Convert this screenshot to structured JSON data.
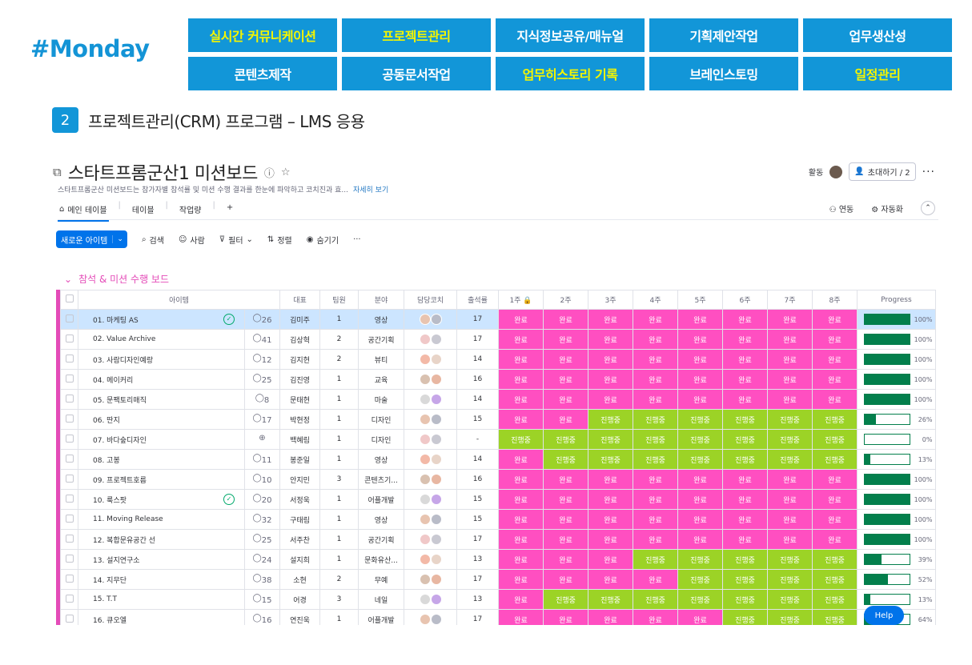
{
  "brand": "#Monday",
  "nav": {
    "row1": [
      {
        "label": "실시간 커뮤니케이션",
        "hl": true
      },
      {
        "label": "프로젝트관리",
        "hl": true
      },
      {
        "label": "지식정보공유/매뉴얼",
        "hl": false
      },
      {
        "label": "기획제안작업",
        "hl": false
      },
      {
        "label": "업무생산성",
        "hl": false
      }
    ],
    "row2": [
      {
        "label": "콘텐츠제작",
        "hl": false
      },
      {
        "label": "공동문서작업",
        "hl": false
      },
      {
        "label": "업무히스토리 기록",
        "hl": true
      },
      {
        "label": "브레인스토밍",
        "hl": false
      },
      {
        "label": "일정관리",
        "hl": true
      }
    ],
    "highlight_color": "#f5f500",
    "bg_color": "#1296d8"
  },
  "section": {
    "number": "2",
    "title": "프로젝트관리(CRM) 프로그램 – LMS 응용"
  },
  "board": {
    "title": "스타트프롬군산1 미션보드",
    "description": "스타트프롬군산 미션보드는 참가자별 참석률 및 미션 수행 결과를 한눈에 파악하고 코치진과 효...",
    "more_link": "자세히 보기",
    "activity": "활동",
    "invite": "초대하기 / 2",
    "tabs": [
      "메인 테이블",
      "테이블",
      "작업량",
      "+"
    ],
    "integrate": "연동",
    "automate": "자동화",
    "new_item": "새로운 아이템",
    "search": "검색",
    "person": "사람",
    "filter": "필터",
    "sort": "정렬",
    "hide": "숨기기",
    "group_title": "참석 & 미션 수행 보드"
  },
  "table": {
    "headers": {
      "item": "아이템",
      "rep": "대표",
      "team": "팀원",
      "field": "분야",
      "coach": "담당코치",
      "att": "출석률",
      "progress": "Progress"
    },
    "weeks": [
      "1주",
      "2주",
      "3주",
      "4주",
      "5주",
      "6주",
      "7주",
      "8주"
    ],
    "status_done": "완료",
    "status_prog": "진행중",
    "rows": [
      {
        "name": "01. 마케팅 AS",
        "check": true,
        "msg": "26",
        "rep": "김미주",
        "team": "1",
        "field": "영상",
        "att": "17",
        "weeks": "DDDDDDDD",
        "progress": 100,
        "progress_label": "100%"
      },
      {
        "name": "02. Value Archive",
        "check": false,
        "msg": "41",
        "rep": "김상혁",
        "team": "2",
        "field": "공간기획",
        "att": "17",
        "weeks": "DDDDDDDD",
        "progress": 100,
        "progress_label": "100%"
      },
      {
        "name": "03. 사람디자인예랑",
        "check": false,
        "msg": "12",
        "rep": "김지현",
        "team": "2",
        "field": "뷰티",
        "att": "14",
        "weeks": "DDDDDDDD",
        "progress": 100,
        "progress_label": "100%"
      },
      {
        "name": "04. 메이커리",
        "check": false,
        "msg": "25",
        "rep": "김진영",
        "team": "1",
        "field": "교육",
        "att": "16",
        "weeks": "DDDDDDDD",
        "progress": 100,
        "progress_label": "100%"
      },
      {
        "name": "05. 문팩토리매직",
        "check": false,
        "msg": "8",
        "rep": "문태현",
        "team": "1",
        "field": "마술",
        "att": "14",
        "weeks": "DDDDDDDD",
        "progress": 100,
        "progress_label": "100%"
      },
      {
        "name": "06. 딴지",
        "check": false,
        "msg": "17",
        "rep": "박현정",
        "team": "1",
        "field": "디자인",
        "att": "15",
        "weeks": "DDPPPPPP",
        "progress": 26,
        "progress_label": "26%"
      },
      {
        "name": "07. 바다숲디자인",
        "check": false,
        "msg": "",
        "rep": "백혜림",
        "team": "1",
        "field": "디자인",
        "att": "-",
        "weeks": "PPPPPPPP",
        "progress": 0,
        "progress_label": "0%"
      },
      {
        "name": "08. 고봉",
        "check": false,
        "msg": "11",
        "rep": "봉준일",
        "team": "1",
        "field": "영상",
        "att": "14",
        "weeks": "DPPPPPPP",
        "progress": 13,
        "progress_label": "13%"
      },
      {
        "name": "09. 프로젝트호름",
        "check": false,
        "msg": "10",
        "rep": "안지민",
        "team": "3",
        "field": "콘텐츠기...",
        "att": "16",
        "weeks": "DDDDDDDD",
        "progress": 100,
        "progress_label": "100%"
      },
      {
        "name": "10. 룩스팟",
        "check": true,
        "msg": "20",
        "rep": "서정욱",
        "team": "1",
        "field": "어플개발",
        "att": "15",
        "weeks": "DDDDDDDD",
        "progress": 100,
        "progress_label": "100%"
      },
      {
        "name": "11. Moving Release",
        "check": false,
        "msg": "32",
        "rep": "구태림",
        "team": "1",
        "field": "영상",
        "att": "15",
        "weeks": "DDDDDDDD",
        "progress": 100,
        "progress_label": "100%"
      },
      {
        "name": "12. 복합문유공간 선",
        "check": false,
        "msg": "25",
        "rep": "서주찬",
        "team": "1",
        "field": "공간기획",
        "att": "17",
        "weeks": "DDDDDDDD",
        "progress": 100,
        "progress_label": "100%"
      },
      {
        "name": "13. 설지연구소",
        "check": false,
        "msg": "24",
        "rep": "설지희",
        "team": "1",
        "field": "문화유산...",
        "att": "13",
        "weeks": "DDDPPPPP",
        "progress": 39,
        "progress_label": "39%"
      },
      {
        "name": "14. 지무단",
        "check": false,
        "msg": "38",
        "rep": "소현",
        "team": "2",
        "field": "무예",
        "att": "17",
        "weeks": "DDDDPPPP",
        "progress": 52,
        "progress_label": "52%"
      },
      {
        "name": "15. T.T",
        "check": false,
        "msg": "15",
        "rep": "어경",
        "team": "3",
        "field": "네일",
        "att": "13",
        "weeks": "DPPPPPPP",
        "progress": 13,
        "progress_label": "13%"
      },
      {
        "name": "16. 큐오엘",
        "check": false,
        "msg": "16",
        "rep": "연진욱",
        "team": "1",
        "field": "어플개발",
        "att": "17",
        "weeks": "DDDDDPPP",
        "progress": 64,
        "progress_label": "64%"
      }
    ]
  },
  "help": "Help",
  "colors": {
    "done": "#ff4fc1",
    "prog": "#9cd326",
    "bar": "#037f4c",
    "accent": "#0073ea",
    "group": "#e44bb8"
  }
}
